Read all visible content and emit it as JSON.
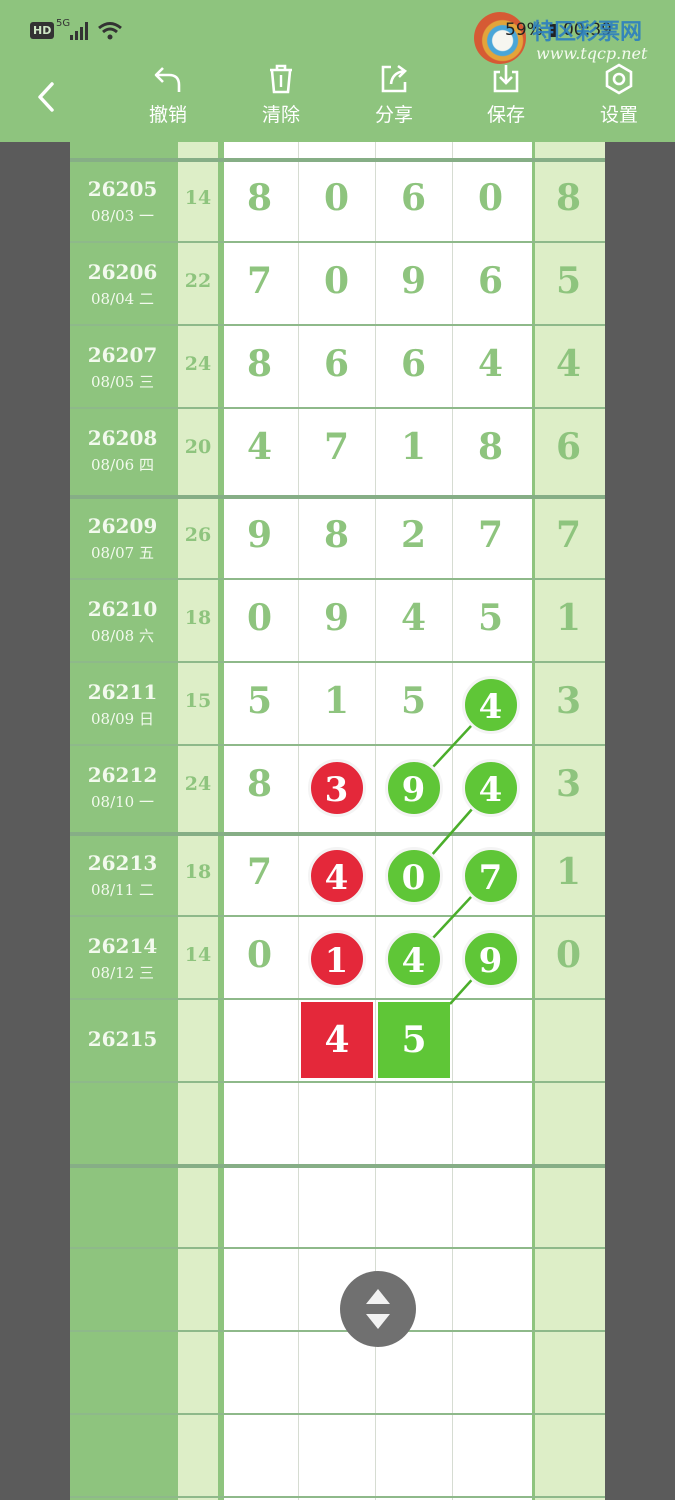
{
  "status": {
    "hd": "HD",
    "network": "5G",
    "battery": "59",
    "time": "00:39"
  },
  "brand": {
    "name": "特区彩票网",
    "url": "www.tqcp.net"
  },
  "toolbar": {
    "undo": "撤销",
    "clear": "清除",
    "share": "分享",
    "save": "保存",
    "settings": "设置"
  },
  "rows": [
    {
      "id": "26205",
      "date": "08/03 一",
      "sum": "14",
      "digits": [
        "8",
        "0",
        "6",
        "0"
      ],
      "last": "8"
    },
    {
      "id": "26206",
      "date": "08/04 二",
      "sum": "22",
      "digits": [
        "7",
        "0",
        "9",
        "6"
      ],
      "last": "5"
    },
    {
      "id": "26207",
      "date": "08/05 三",
      "sum": "24",
      "digits": [
        "8",
        "6",
        "6",
        "4"
      ],
      "last": "4"
    },
    {
      "id": "26208",
      "date": "08/06 四",
      "sum": "20",
      "digits": [
        "4",
        "7",
        "1",
        "8"
      ],
      "last": "6"
    },
    {
      "id": "26209",
      "date": "08/07 五",
      "sum": "26",
      "digits": [
        "9",
        "8",
        "2",
        "7"
      ],
      "last": "7"
    },
    {
      "id": "26210",
      "date": "08/08 六",
      "sum": "18",
      "digits": [
        "0",
        "9",
        "4",
        "5"
      ],
      "last": "1"
    },
    {
      "id": "26211",
      "date": "08/09 日",
      "sum": "15",
      "digits": [
        "5",
        "1",
        "5",
        "4"
      ],
      "last": "3"
    },
    {
      "id": "26212",
      "date": "08/10 一",
      "sum": "24",
      "digits": [
        "8",
        "3",
        "9",
        "4"
      ],
      "last": "3"
    },
    {
      "id": "26213",
      "date": "08/11 二",
      "sum": "18",
      "digits": [
        "7",
        "4",
        "0",
        "7"
      ],
      "last": "1"
    },
    {
      "id": "26214",
      "date": "08/12 三",
      "sum": "14",
      "digits": [
        "0",
        "1",
        "4",
        "9"
      ],
      "last": "0"
    }
  ],
  "pending": {
    "id": "26215",
    "picks": [
      "4",
      "5"
    ]
  },
  "highlight_colors": {
    "red": "#e4283a",
    "green": "#5fc637",
    "theme": "#8ec47e"
  }
}
